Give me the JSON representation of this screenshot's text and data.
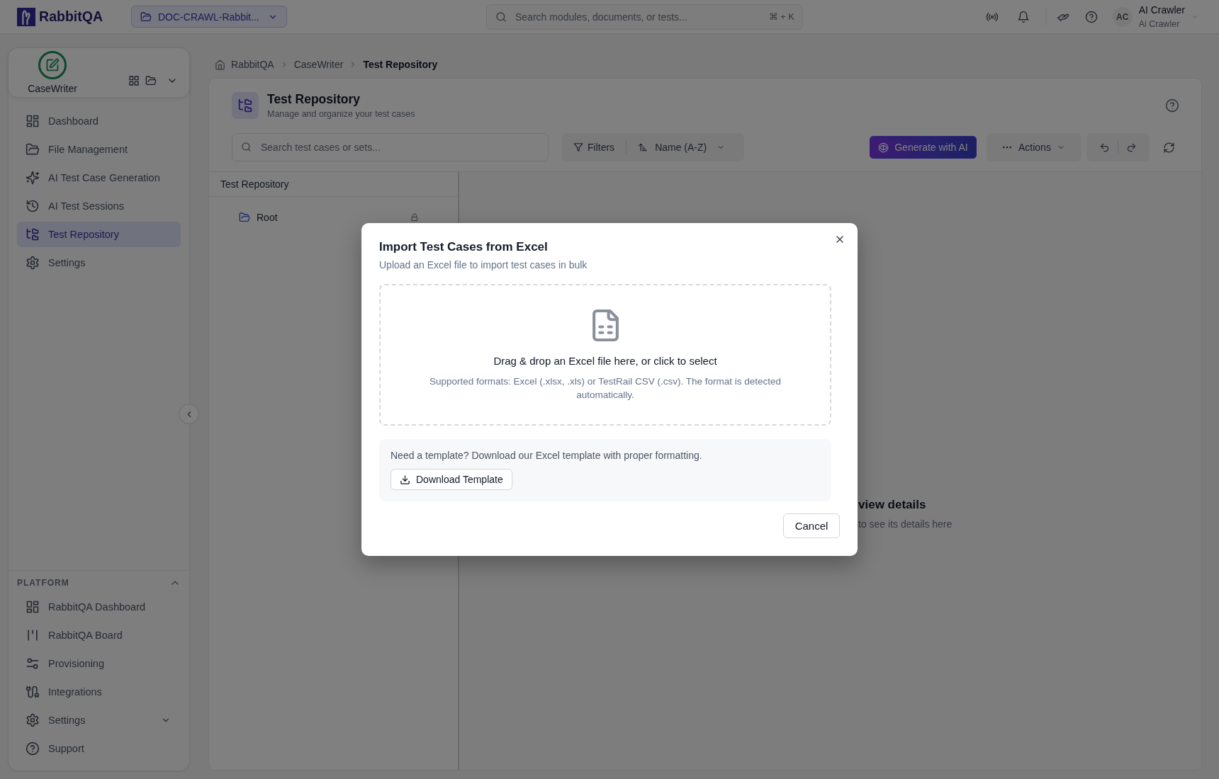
{
  "topbar": {
    "logo": "RabbitQA",
    "project": "DOC-CRAWL-Rabbit...",
    "search": {
      "placeholder": "Search modules, documents, or tests...",
      "shortcut": "⌘ + K"
    },
    "user": {
      "initials": "AC",
      "name": "AI Crawler",
      "subtitle": "Ai Crawler"
    }
  },
  "app_switcher": {
    "label": "CaseWriter"
  },
  "sidebar": {
    "items": [
      {
        "label": "Dashboard",
        "selected": false
      },
      {
        "label": "File Management",
        "selected": false
      },
      {
        "label": "AI Test Case Generation",
        "selected": false
      },
      {
        "label": "AI Test Sessions",
        "selected": false
      },
      {
        "label": "Test Repository",
        "selected": true
      },
      {
        "label": "Settings",
        "selected": false
      }
    ]
  },
  "platform": {
    "title": "PLATFORM",
    "expanded": true,
    "items": [
      {
        "label": "RabbitQA Dashboard",
        "kind": "link",
        "selected": false
      },
      {
        "label": "RabbitQA Board",
        "kind": "link",
        "selected": false
      },
      {
        "label": "Provisioning",
        "kind": "link",
        "selected": false
      },
      {
        "label": "Integrations",
        "kind": "link",
        "selected": false
      },
      {
        "label": "Settings",
        "kind": "group",
        "selected": false,
        "expanded": false
      },
      {
        "label": "Support",
        "kind": "link",
        "selected": false
      }
    ]
  },
  "breadcrumb": [
    "RabbitQA",
    "CaseWriter",
    "Test Repository"
  ],
  "page": {
    "title": "Test Repository",
    "subtitle": "Manage and organize your test cases"
  },
  "toolbar": {
    "search": {
      "placeholder": "Search test cases or sets..."
    },
    "filters": "Filters",
    "sort": "Name (A-Z)",
    "generate": "Generate with AI",
    "actions": "Actions"
  },
  "tree": {
    "title": "Test Repository",
    "nodes": [
      {
        "label": "Root",
        "locked": true
      }
    ]
  },
  "detail_hint": {
    "heading": "view details",
    "text": "to see its details here"
  },
  "dialog": {
    "title": "Import Test Cases from Excel",
    "subtitle": "Upload an Excel file to import test cases in bulk",
    "dropzone": {
      "prompt": "Drag & drop an Excel file here, or click to select",
      "hint": "Supported formats: Excel (.xlsx, .xls) or TestRail CSV (.csv). The format is detected automatically."
    },
    "template": {
      "text": "Need a template? Download our Excel template with proper formatting.",
      "button": "Download Template"
    },
    "buttons": [
      "Cancel"
    ]
  }
}
